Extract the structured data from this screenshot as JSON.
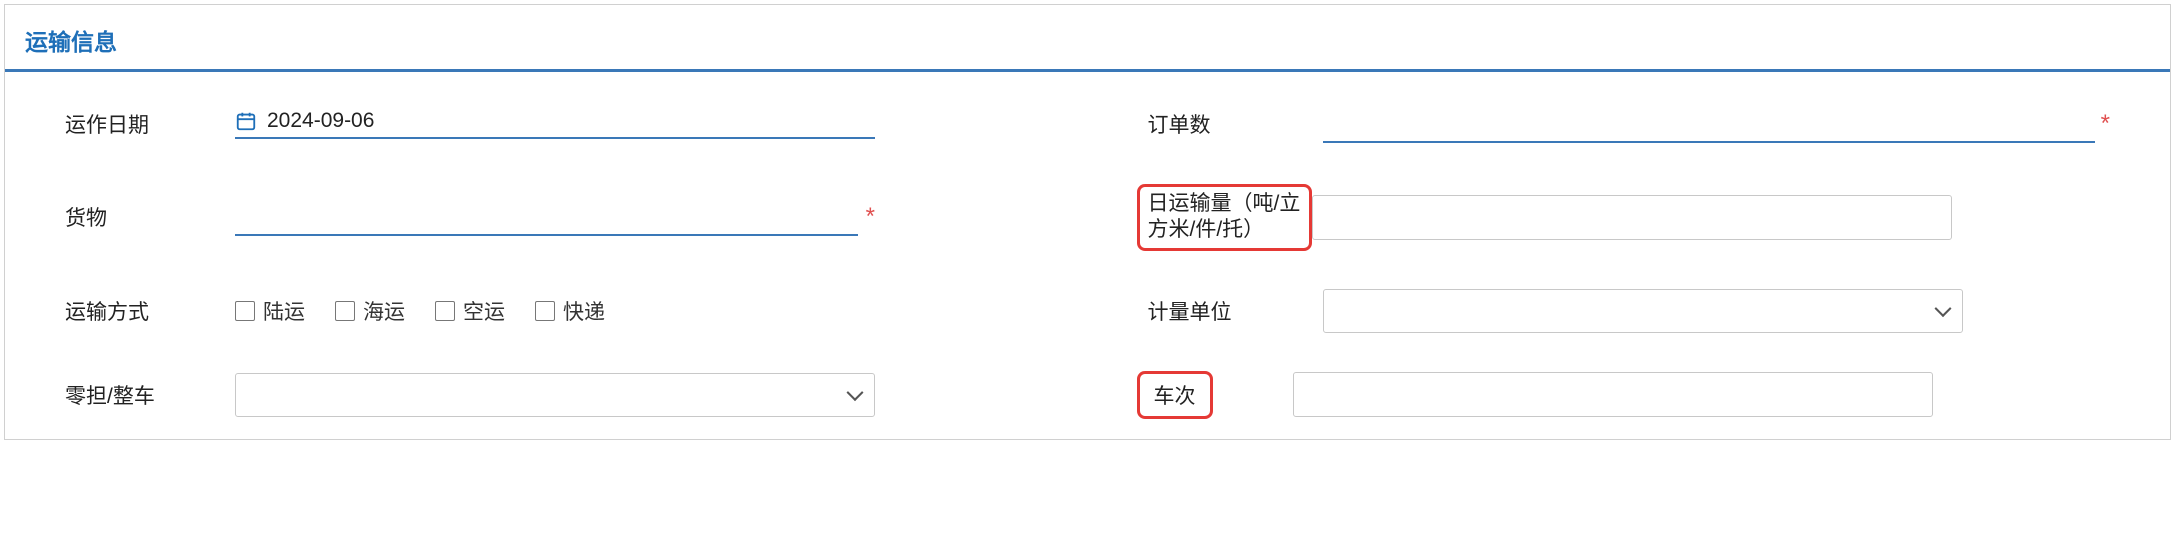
{
  "section": {
    "title": "运输信息"
  },
  "form": {
    "operation_date": {
      "label": "运作日期",
      "value": "2024-09-06"
    },
    "order_count": {
      "label": "订单数",
      "value": ""
    },
    "cargo": {
      "label": "货物",
      "value": ""
    },
    "daily_volume": {
      "label": "日运输量（吨/立方米/件/托）",
      "value": ""
    },
    "transport_mode": {
      "label": "运输方式",
      "options": {
        "land": "陆运",
        "sea": "海运",
        "air": "空运",
        "express": "快递"
      }
    },
    "unit": {
      "label": "计量单位",
      "value": ""
    },
    "ltl_ftl": {
      "label": "零担/整车",
      "value": ""
    },
    "trips": {
      "label": "车次",
      "value": ""
    }
  },
  "required_marker": "*"
}
